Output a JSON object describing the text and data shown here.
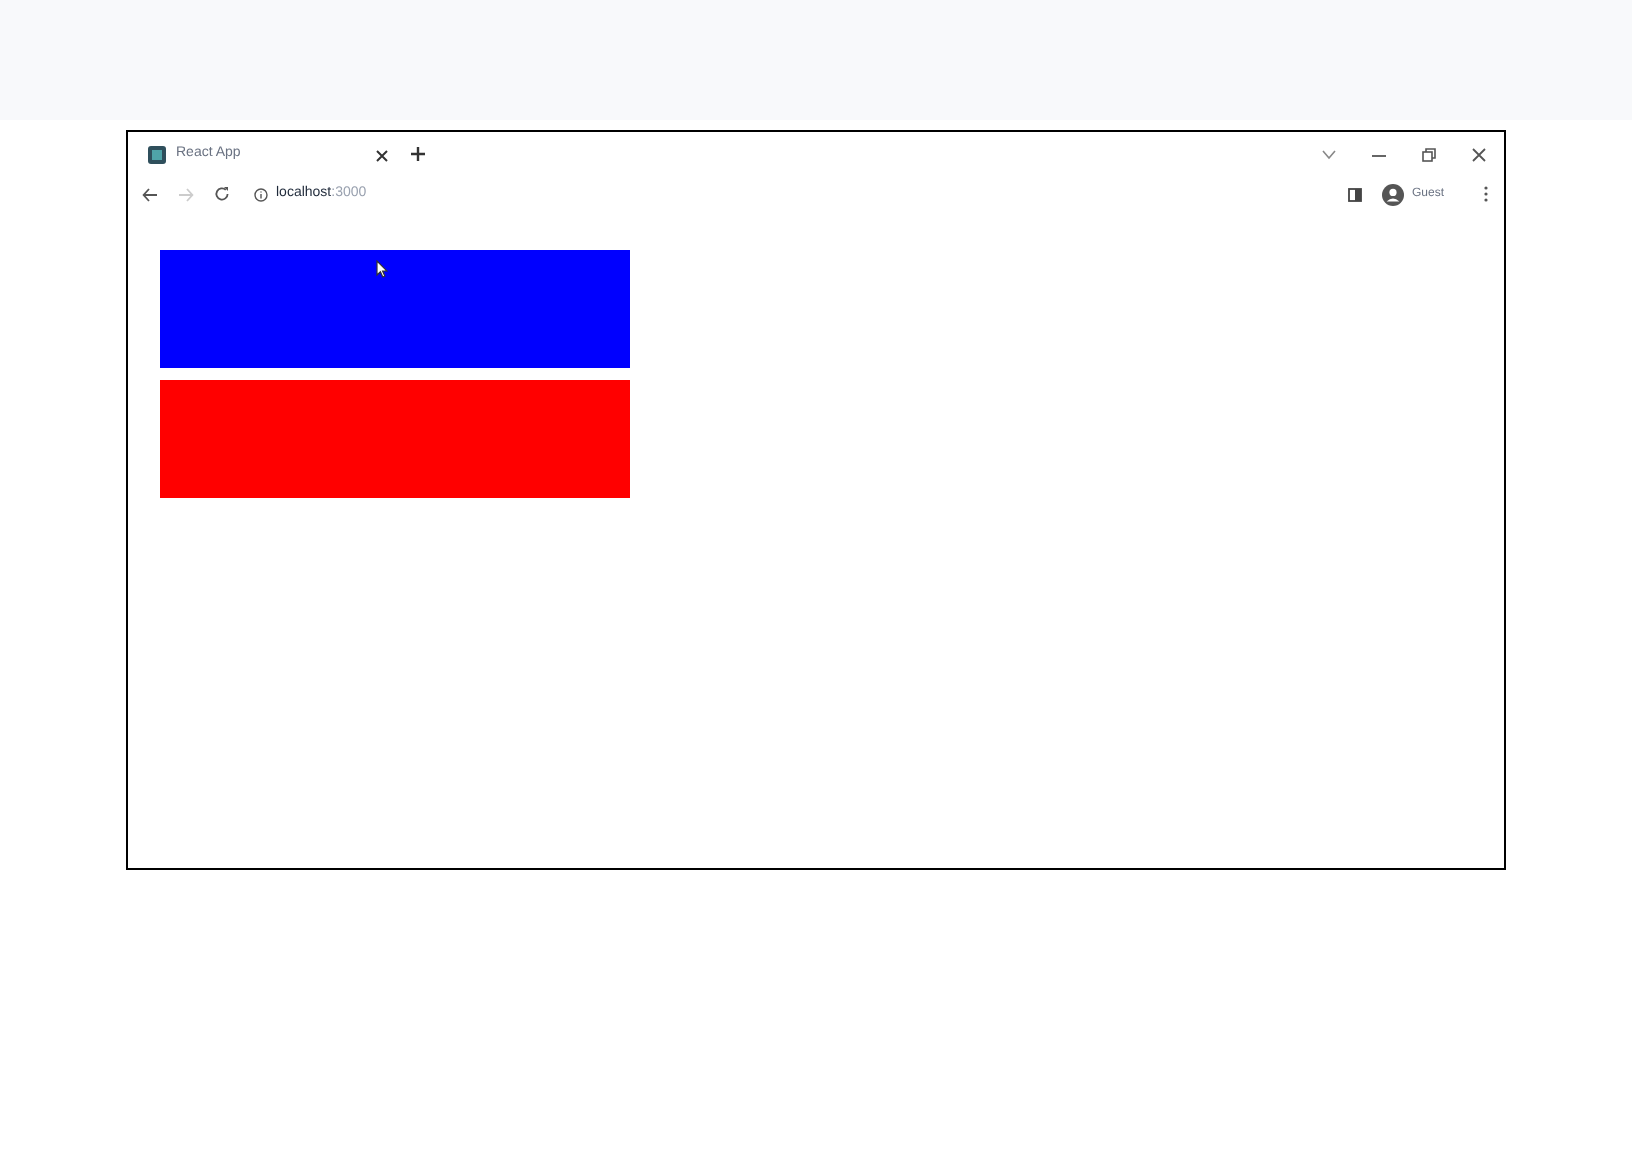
{
  "tab": {
    "title": "React App",
    "selected": true
  },
  "address_bar": {
    "host": "localhost",
    "port": ":3000"
  },
  "profile": {
    "label": "Guest"
  },
  "blocks": [
    {
      "color": "#0000ff"
    },
    {
      "color": "#ff0000"
    }
  ]
}
